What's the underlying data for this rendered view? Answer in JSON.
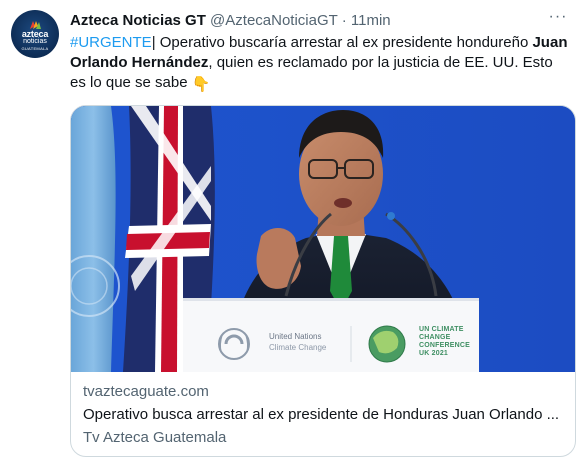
{
  "account": {
    "display_name": "Azteca Noticias GT",
    "handle": "@AztecaNoticiaGT",
    "separator": "·",
    "time": "11min",
    "avatar": {
      "line1": "azteca",
      "line2": "noticias",
      "line3": "GUATEMALA"
    }
  },
  "more_icon": "···",
  "tweet": {
    "hashtag": "#URGENTE",
    "part1": "| Operativo buscaría arrestar al ex presidente hondureño ",
    "bold_name": "Juan Orlando Hernández",
    "part2": ", quien es reclamado por la justicia de EE. UU. Esto es lo que se sabe ",
    "emoji": "👇",
    "emoji_icon": "backhand-index-pointing-down-icon"
  },
  "card": {
    "image_podium": {
      "un_title": "United Nations",
      "un_subtitle": "Climate Change",
      "cop_lines": [
        "UN CLIMATE",
        "CHANGE",
        "CONFERENCE",
        "UK 2021"
      ]
    },
    "domain": "tvaztecaguate.com",
    "title": "Operativo busca arrestar al ex presidente de Honduras Juan Orlando ...",
    "source": "Tv Azteca Guatemala"
  },
  "colors": {
    "link_blue": "#1d9bf0",
    "text_primary": "#0f1419",
    "text_secondary": "#536471",
    "border": "#cfd9de"
  }
}
